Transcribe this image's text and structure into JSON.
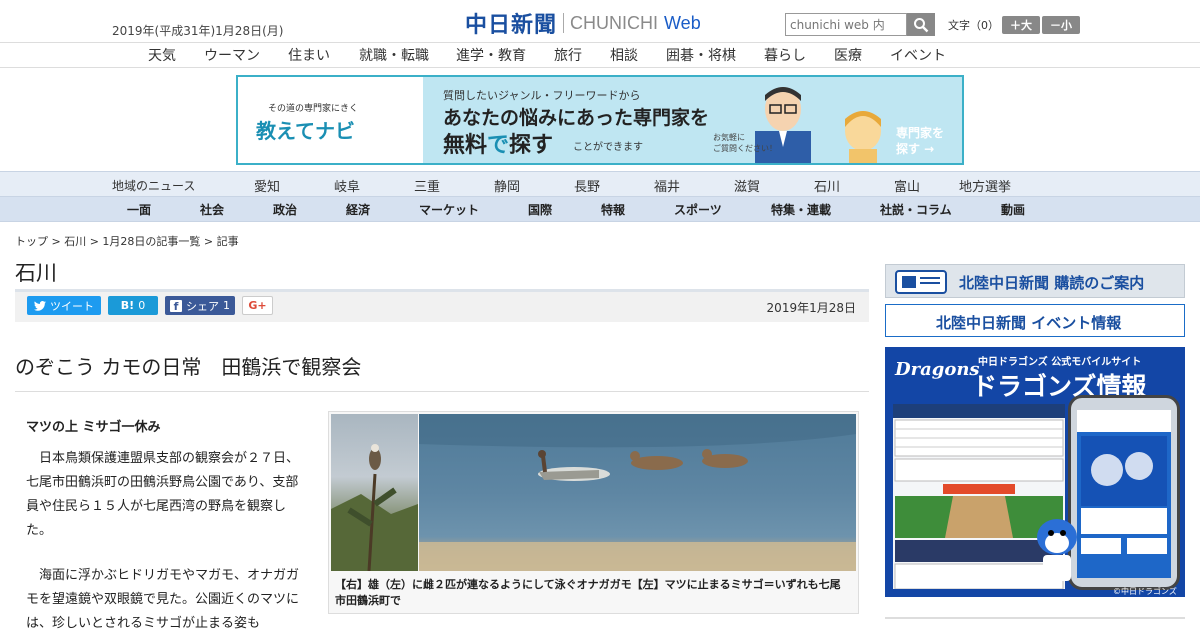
{
  "header": {
    "date": "2019年(平成31年)1月28日(月)",
    "logo_kanji": "中日新聞",
    "logo_en": "CHUNICHI",
    "logo_web": "Web",
    "search_placeholder": "chunichi web 内",
    "font_size_label": "文字（0）",
    "font_plus": "＋大",
    "font_minus": "－小"
  },
  "global_nav": [
    "天気",
    "ウーマン",
    "住まい",
    "就職・転職",
    "進学・教育",
    "旅行",
    "相談",
    "囲碁・将棋",
    "暮らし",
    "医療",
    "イベント"
  ],
  "banner": {
    "sub": "その道の専門家にきく",
    "name": "教えてナビ",
    "line1": "質問したいジャンル・フリーワードから",
    "line2": "あなたの悩みにあった専門家を",
    "line3a": "無料",
    "line3b": "で",
    "line3c": "探す",
    "line4": "ことができます",
    "note": "お気軽に\nご質問ください！",
    "cta": "専門家を\n探す →"
  },
  "region_nav": {
    "label": "地域のニュース",
    "items": [
      "愛知",
      "岐阜",
      "三重",
      "静岡",
      "長野",
      "福井",
      "滋賀",
      "石川",
      "富山",
      "地方選挙"
    ]
  },
  "category_nav": [
    "一面",
    "社会",
    "政治",
    "経済",
    "マーケット",
    "国際",
    "特報",
    "スポーツ",
    "特集・連載",
    "社説・コラム",
    "動画"
  ],
  "breadcrumb": "トップ > 石川 > 1月28日の記事一覧 > 記事",
  "section_title": "石川",
  "share": {
    "tweet": "ツイート",
    "hatena": "B!",
    "hatena_count": "0",
    "facebook": "シェア",
    "facebook_count": "1",
    "gplus": "G+"
  },
  "article": {
    "date": "2019年1月28日",
    "headline": "のぞこう カモの日常　田鶴浜で観察会",
    "subhead": "マツの上 ミサゴ一休み",
    "para1": "　日本鳥類保護連盟県支部の観察会が２７日、七尾市田鶴浜町の田鶴浜野鳥公園であり、支部員や住民ら１５人が七尾西湾の野鳥を観察した。",
    "para2": "　海面に浮かぶヒドリガモやマガモ、オナガガモを望遠鏡や双眼鏡で見た。公園近くのマツには、珍しいとされるミサゴが止まる姿も",
    "caption": "【右】雄（左）に雌２匹が連なるようにして泳ぐオナガガモ【左】マツに止まるミサゴ＝いずれも七尾市田鶴浜町で"
  },
  "sidebar": {
    "subscribe": "北陸中日新聞 購読のご案内",
    "events": "北陸中日新聞 イベント情報",
    "ad": {
      "team": "Dragons",
      "tagline": "中日ドラゴンズ 公式モバイルサイト",
      "title": "ドラゴンズ情報",
      "copyright": "©中日ドラゴンズ"
    }
  },
  "colors": {
    "brand_blue": "#1a4fa0",
    "twitter": "#1d9bf0",
    "hatena": "#1b9ad8",
    "facebook": "#3b5998"
  }
}
